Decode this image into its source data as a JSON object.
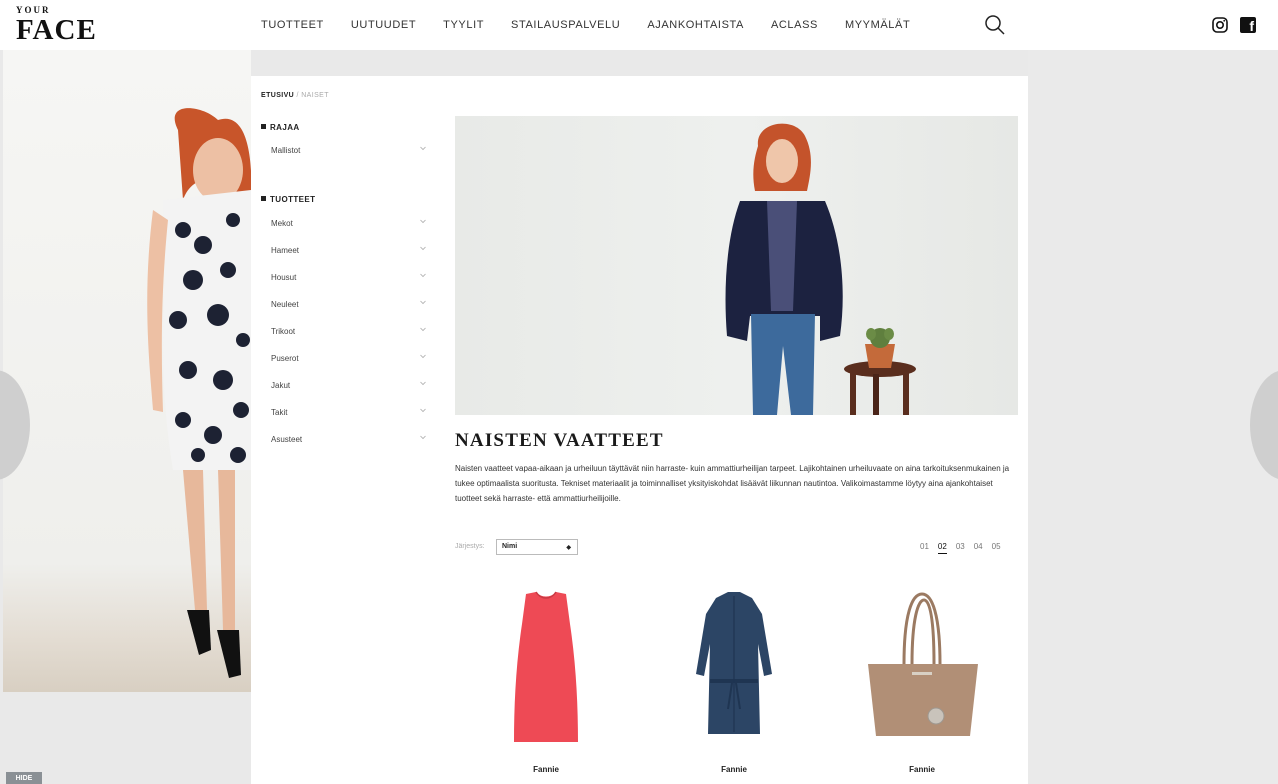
{
  "logo": {
    "your": "YOUR",
    "face": "FACE"
  },
  "nav": [
    "TUOTTEET",
    "UUTUUDET",
    "TYYLIT",
    "STAILAUSPALVELU",
    "AJANKOHTAISTA",
    "ACLASS",
    "MYYMÄLÄT"
  ],
  "icons": {
    "search": "search-icon",
    "instagram": "instagram-icon",
    "facebook": "facebook-icon"
  },
  "facebook_glyph": "f",
  "breadcrumb": {
    "home": "ETUSIVU",
    "separator": "/",
    "current": "NAISET"
  },
  "sidebar": {
    "filter_heading": "RAJAA",
    "filter_items": [
      "Mallistot"
    ],
    "products_heading": "TUOTTEET",
    "product_items": [
      "Mekot",
      "Hameet",
      "Housut",
      "Neuleet",
      "Trikoot",
      "Puserot",
      "Jakut",
      "Takit",
      "Asusteet"
    ]
  },
  "title": "NAISTEN VAATTEET",
  "description": "Naisten vaatteet vapaa-aikaan ja urheiluun täyttävät niin harraste- kuin ammattiurheilijan tarpeet. Lajikohtainen urheiluvaate on aina tarkoituksenmukainen ja tukee optimaalista suoritusta. Tekniset materiaalit ja toiminnalliset yksityiskohdat lisäävät liikunnan nautintoa. Valikoimastamme löytyy aina ajankohtaiset tuotteet sekä harraste- että ammattiurheilijoille.",
  "sort": {
    "label": "Järjestys:",
    "value": "Nimi",
    "arrow": "◆"
  },
  "pagination": {
    "pages": [
      "01",
      "02",
      "03",
      "04",
      "05"
    ],
    "active": "02"
  },
  "products": [
    {
      "name": "Fannie",
      "color": "#ee4a55"
    },
    {
      "name": "Fannie",
      "color": "#2c4565"
    },
    {
      "name": "Fannie",
      "color": "#b18f76"
    }
  ],
  "hide_label": "HIDE"
}
